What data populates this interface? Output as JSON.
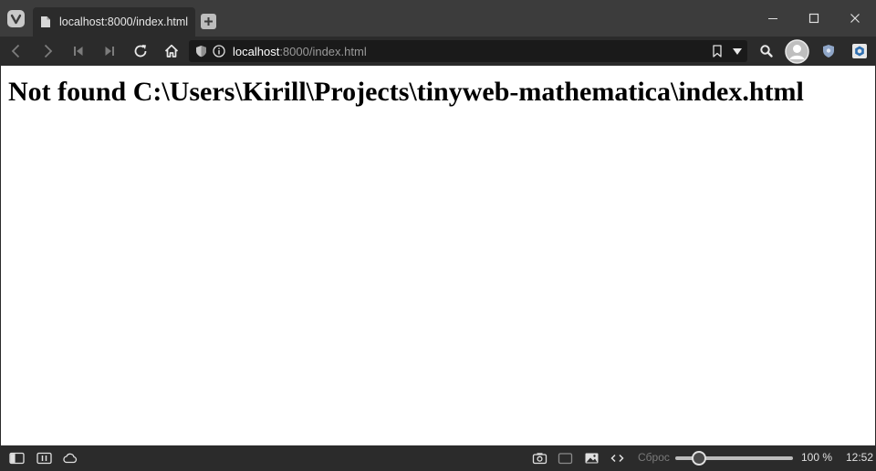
{
  "tab": {
    "title": "localhost:8000/index.html"
  },
  "address_bar": {
    "host": "localhost",
    "rest": ":8000/index.html"
  },
  "page": {
    "heading": "Not found C:\\Users\\Kirill\\Projects\\tinyweb-mathematica\\index.html"
  },
  "status_bar": {
    "reset_label": "Сброс",
    "zoom_percent": 100,
    "zoom_label": "100 %",
    "clock": "12:52"
  },
  "icons": {
    "toolbar": [
      "back-icon",
      "forward-icon",
      "rewind-icon",
      "fast-forward-icon",
      "reload-icon",
      "home-icon"
    ],
    "address": [
      "shield-icon",
      "info-icon",
      "bookmark-icon",
      "dropdown-icon"
    ],
    "toolbar_right": [
      "search-icon",
      "profile-icon",
      "extension-shield-icon",
      "extension-puzzle-icon"
    ],
    "status_left": [
      "panel-toggle-icon",
      "tiling-icon",
      "sync-cloud-icon"
    ],
    "status_right": [
      "capture-icon",
      "window-icon",
      "image-icon",
      "code-icon"
    ]
  },
  "colors": {
    "chrome_dark": "#2b2b2b",
    "tabbar": "#3c3c3c",
    "url_field": "#1a1a1a",
    "page_background": "#ffffff"
  }
}
